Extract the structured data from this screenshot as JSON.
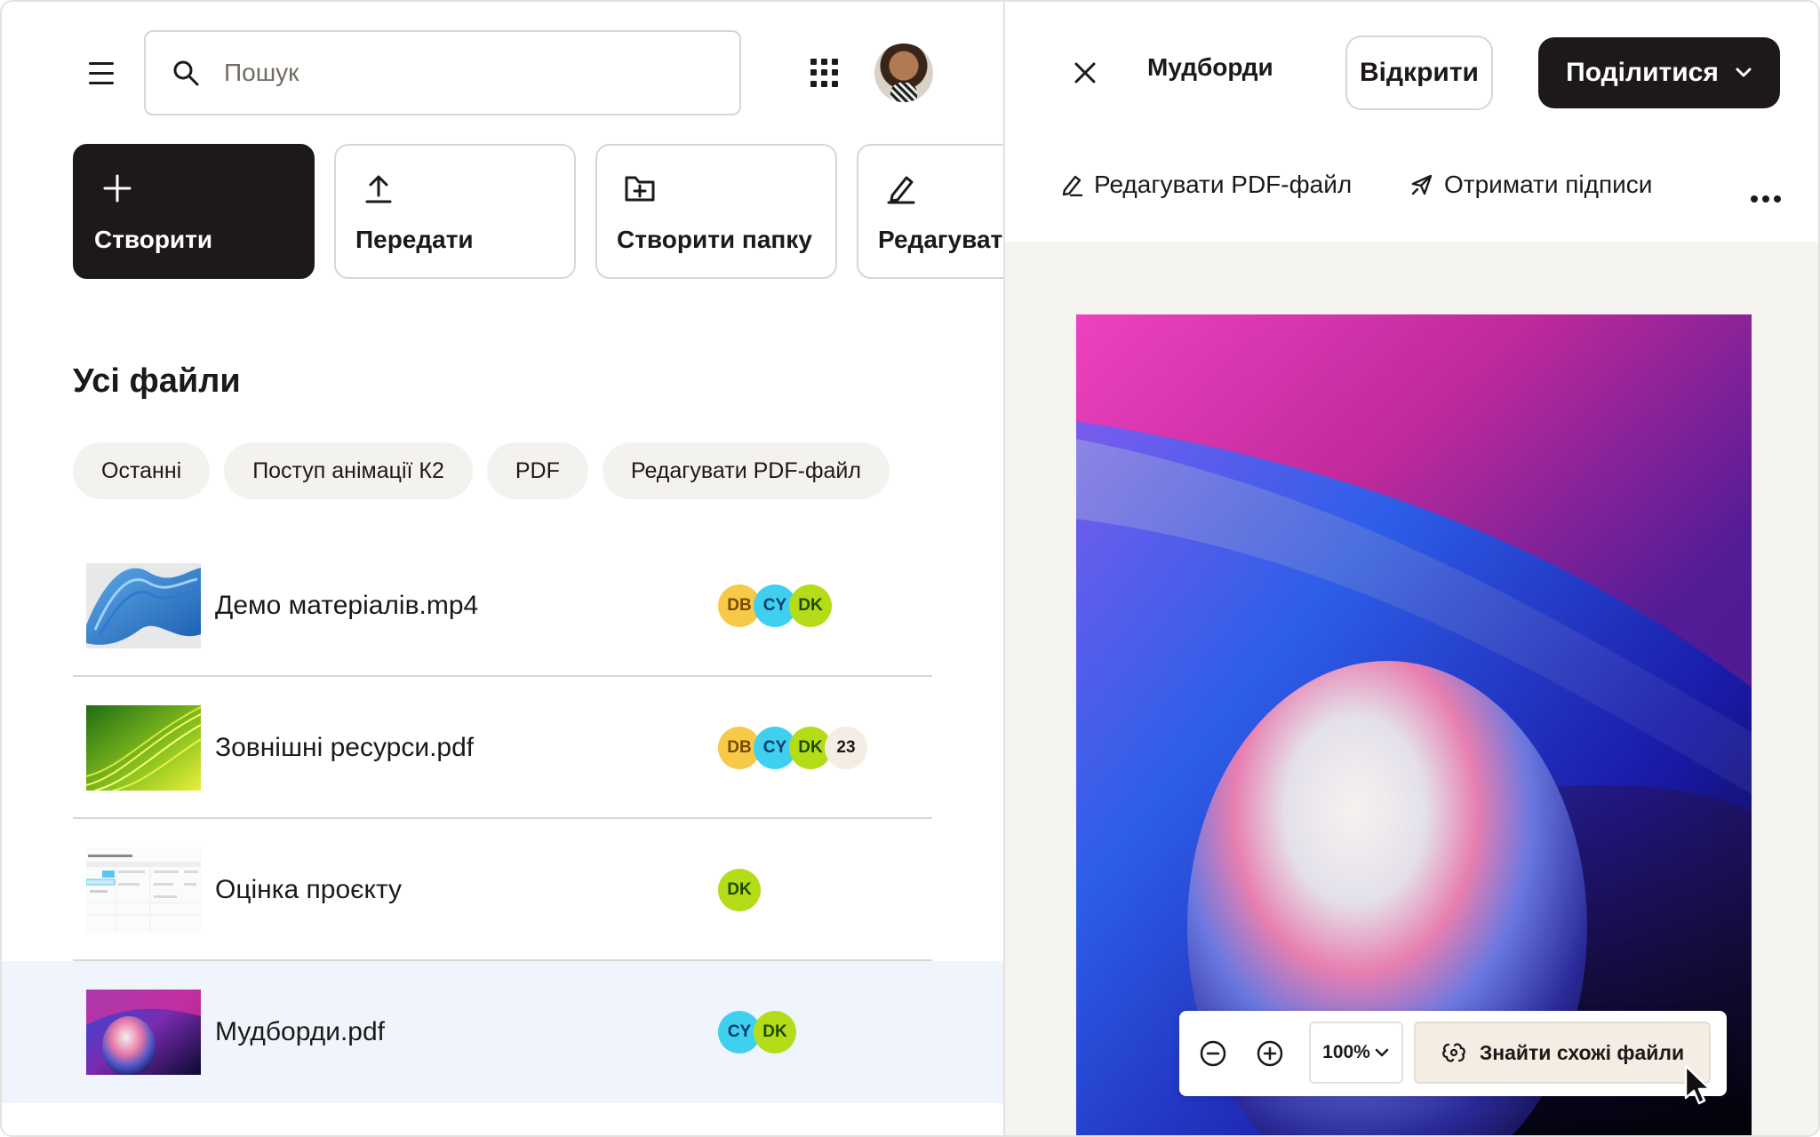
{
  "header": {
    "search_placeholder": "Пошук"
  },
  "actions": [
    {
      "label": "Створити",
      "icon": "plus-icon"
    },
    {
      "label": "Передати",
      "icon": "upload-icon"
    },
    {
      "label": "Створити папку",
      "icon": "folder-plus-icon"
    },
    {
      "label": "Редагувати",
      "icon": "pencil-icon"
    }
  ],
  "section_title": "Усі файли",
  "chips": [
    "Останні",
    "Поступ анімації К2",
    "PDF",
    "Редагувати PDF-файл"
  ],
  "files": [
    {
      "name": "Демо матеріалів.mp4",
      "people": [
        "DB",
        "CY",
        "DK"
      ],
      "extra": ""
    },
    {
      "name": "Зовнішні ресурси.pdf",
      "people": [
        "DB",
        "CY",
        "DK"
      ],
      "extra": "23"
    },
    {
      "name": "Оцінка проєкту",
      "people": [
        "DK"
      ],
      "extra": ""
    },
    {
      "name": "Мудборди.pdf",
      "people": [
        "CY",
        "DK"
      ],
      "extra": "",
      "selected": true
    }
  ],
  "preview": {
    "title": "Мудборди",
    "open_label": "Відкрити",
    "share_label": "Поділитися",
    "edit_pdf_label": "Редагувати PDF-файл",
    "signatures_label": "Отримати підписи",
    "zoom_value": "100%",
    "similar_label": "Знайти схожі файли"
  },
  "colors": {
    "primary_dark": "#1e1919",
    "badge_db": "#f7c948",
    "badge_cy": "#3fd0f0",
    "badge_dk": "#b4dc19",
    "selected_row": "#f0f5fd"
  }
}
